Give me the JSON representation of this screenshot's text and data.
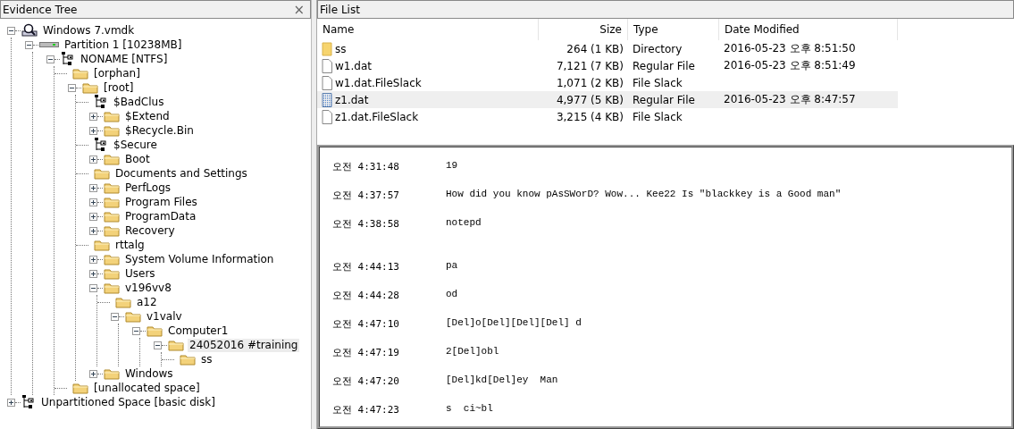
{
  "evidence_tree": {
    "title": "Evidence Tree",
    "close": "×",
    "nodes": [
      {
        "label": "Windows 7.vmdk",
        "kind": "disk",
        "expanded": true,
        "selected": false,
        "children": [
          {
            "label": "Partition 1 [10238MB]",
            "kind": "partition",
            "expanded": true,
            "selected": false,
            "children": [
              {
                "label": "NONAME [NTFS]",
                "kind": "filesystem",
                "expanded": true,
                "selected": false,
                "children": [
                  {
                    "label": "[orphan]",
                    "kind": "folder",
                    "selected": false
                  },
                  {
                    "label": "[root]",
                    "kind": "folder",
                    "expanded": true,
                    "selected": false,
                    "children": [
                      {
                        "label": "$BadClus",
                        "kind": "filesystem",
                        "selected": false
                      },
                      {
                        "label": "$Extend",
                        "kind": "folder",
                        "expanded": false,
                        "selected": false
                      },
                      {
                        "label": "$Recycle.Bin",
                        "kind": "folder",
                        "expanded": false,
                        "selected": false
                      },
                      {
                        "label": "$Secure",
                        "kind": "filesystem",
                        "selected": false
                      },
                      {
                        "label": "Boot",
                        "kind": "folder",
                        "expanded": false,
                        "selected": false
                      },
                      {
                        "label": "Documents and Settings",
                        "kind": "folder",
                        "selected": false
                      },
                      {
                        "label": "PerfLogs",
                        "kind": "folder",
                        "expanded": false,
                        "selected": false
                      },
                      {
                        "label": "Program Files",
                        "kind": "folder",
                        "expanded": false,
                        "selected": false
                      },
                      {
                        "label": "ProgramData",
                        "kind": "folder",
                        "expanded": false,
                        "selected": false
                      },
                      {
                        "label": "Recovery",
                        "kind": "folder",
                        "expanded": false,
                        "selected": false
                      },
                      {
                        "label": "rttalg",
                        "kind": "folder",
                        "selected": false
                      },
                      {
                        "label": "System Volume Information",
                        "kind": "folder",
                        "expanded": false,
                        "selected": false
                      },
                      {
                        "label": "Users",
                        "kind": "folder",
                        "expanded": false,
                        "selected": false
                      },
                      {
                        "label": "v196vv8",
                        "kind": "folder",
                        "expanded": true,
                        "selected": false,
                        "children": [
                          {
                            "label": "a12",
                            "kind": "folder",
                            "selected": false
                          },
                          {
                            "label": "v1valv",
                            "kind": "folder",
                            "expanded": true,
                            "selected": false,
                            "children": [
                              {
                                "label": "Computer1",
                                "kind": "folder",
                                "expanded": true,
                                "selected": false,
                                "children": [
                                  {
                                    "label": "24052016 #training",
                                    "kind": "folder",
                                    "expanded": true,
                                    "selected": true,
                                    "children": [
                                      {
                                        "label": "ss",
                                        "kind": "folder",
                                        "selected": false
                                      }
                                    ]
                                  }
                                ]
                              }
                            ]
                          }
                        ]
                      },
                      {
                        "label": "Windows",
                        "kind": "folder",
                        "expanded": false,
                        "selected": false
                      }
                    ]
                  },
                  {
                    "label": "[unallocated space]",
                    "kind": "folder",
                    "selected": false
                  }
                ]
              }
            ]
          }
        ]
      },
      {
        "label": "Unpartitioned Space [basic disk]",
        "kind": "filesystem",
        "expanded": false,
        "selected": false
      }
    ]
  },
  "file_list": {
    "title": "File List",
    "columns": [
      "Name",
      "Size",
      "Type",
      "Date Modified"
    ],
    "rows": [
      {
        "kind": "folder",
        "name": "ss",
        "size": "264 (1 KB)",
        "type": "Directory",
        "modified": "2016-05-23 오후 8:51:50",
        "selected": false
      },
      {
        "kind": "file",
        "name": "w1.dat",
        "size": "7,121 (7 KB)",
        "type": "Regular File",
        "modified": "2016-05-23 오후 8:51:49",
        "selected": false
      },
      {
        "kind": "file",
        "name": "w1.dat.FileSlack",
        "size": "1,071 (2 KB)",
        "type": "File Slack",
        "selected": false
      },
      {
        "kind": "dotted-file",
        "name": "z1.dat",
        "size": "4,977 (5 KB)",
        "type": "Regular File",
        "modified": "2016-05-23 오후 8:47:57",
        "selected": true
      },
      {
        "kind": "file",
        "name": "z1.dat.FileSlack",
        "size": "3,215 (4 KB)",
        "type": "File Slack",
        "selected": false
      }
    ]
  },
  "viewer": {
    "blocks": [
      {
        "lines": [
          {
            "time": "오전 4:31:48",
            "text": "19"
          },
          {
            "time": "오전 4:37:57",
            "text": "How did you know pAsSWorD? Wow... Kee22 Is \"blackkey is a Good man\""
          },
          {
            "time": "오전 4:38:58",
            "text": "notepd"
          }
        ]
      },
      {
        "lines": [
          {
            "time": "오전 4:44:13",
            "text": "pa"
          },
          {
            "time": "오전 4:44:28",
            "text": "od"
          },
          {
            "time": "오전 4:47:10",
            "text": "[Del]o[Del][Del][Del] d"
          },
          {
            "time": "오전 4:47:19",
            "text": "2[Del]obl"
          },
          {
            "time": "오전 4:47:20",
            "text": "[Del]kd[Del]ey  Man"
          },
          {
            "time": "오전 4:47:23",
            "text": "s  ci~bl"
          }
        ]
      }
    ]
  }
}
